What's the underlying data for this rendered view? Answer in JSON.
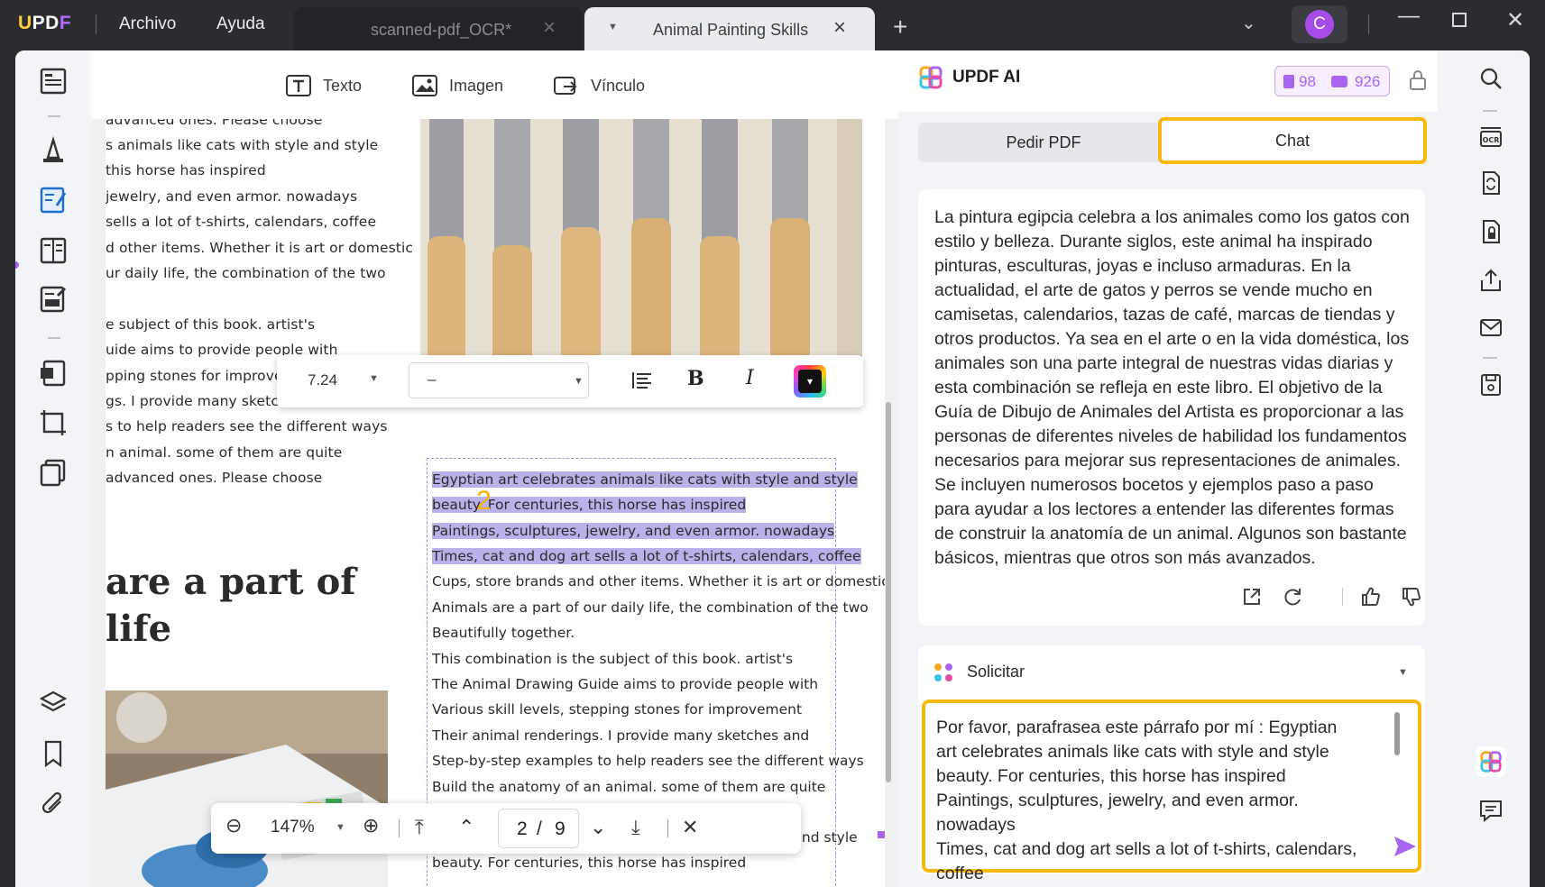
{
  "titlebar": {
    "logo": "UPDF",
    "menu": [
      "Archivo",
      "Ayuda"
    ],
    "tabs": [
      {
        "label": "scanned-pdf_OCR*",
        "active": false
      },
      {
        "label": "Animal Painting Skills",
        "active": true
      }
    ],
    "avatar_initial": "C"
  },
  "doc_toolbar": {
    "tools": [
      {
        "label": "Texto",
        "icon": "text-tool-icon"
      },
      {
        "label": "Imagen",
        "icon": "image-tool-icon"
      },
      {
        "label": "Vínculo",
        "icon": "link-tool-icon"
      }
    ]
  },
  "left_column_lines": [
    "advanced ones. Please choose",
    "s animals like cats with style and style",
    "this horse has inspired",
    "jewelry, and even armor. nowadays",
    "sells a lot of t-shirts, calendars, coffee",
    "d other items. Whether it is art or domestic",
    "ur daily life, the combination of the two",
    "",
    "e subject of this book. artist's",
    "uide aims to provide people with",
    "pping stones for improveme",
    "gs. I provide many sketches a",
    "s to help readers see the different ways",
    "n animal. some of them are quite",
    "advanced ones. Please choose"
  ],
  "left_heading": [
    "are a part of",
    " life"
  ],
  "text_box": {
    "lines": [
      {
        "text": "Egyptian art celebrates animals like cats with style and style",
        "highlight": true
      },
      {
        "text": "beauty. For centuries, this horse has inspired",
        "highlight": true
      },
      {
        "text": "Paintings, sculptures, jewelry, and even armor. nowadays",
        "highlight": true
      },
      {
        "text": "Times, cat and dog art sells a lot of t-shirts, calendars, coffee",
        "highlight": true
      },
      {
        "text": "Cups, store brands and other items. Whether it is art or domestic",
        "highlight": false
      },
      {
        "text": "Animals are a part of our daily life, the combination of the two",
        "highlight": false
      },
      {
        "text": "Beautifully together.",
        "highlight": false
      },
      {
        "text": "This combination is the subject of this book. artist's",
        "highlight": false
      },
      {
        "text": "The Animal Drawing Guide aims to provide people with",
        "highlight": false
      },
      {
        "text": "Various skill levels, stepping stones for improvement",
        "highlight": false
      },
      {
        "text": "Their animal renderings. I provide many sketches and",
        "highlight": false
      },
      {
        "text": "Step-by-step examples to help readers see the different ways",
        "highlight": false
      },
      {
        "text": "Build the anatomy of an animal. some of them are quite",
        "highlight": false
      },
      {
        "text": "se",
        "highlight": false
      },
      {
        "text": "Egyptian art celebrates animals like cats with style and style",
        "highlight": false
      },
      {
        "text": "beauty. For centuries, this horse has inspired",
        "highlight": false
      }
    ]
  },
  "format_bar": {
    "font_size": "7.24",
    "font_name": "–",
    "bold": "B",
    "italic": "I"
  },
  "zoom_bar": {
    "zoom": "147%",
    "current_page": "2",
    "page_sep": "/",
    "total_pages": "9"
  },
  "markers": {
    "one": "1",
    "two": "2"
  },
  "ai_panel": {
    "title": "UPDF AI",
    "credits_pdf": "98",
    "credits_chat": "926",
    "tabs": {
      "ask_pdf": "Pedir PDF",
      "chat": "Chat"
    },
    "answer": "La pintura egipcia celebra a los animales como los gatos con estilo y belleza. Durante siglos, este animal ha inspirado pinturas, esculturas, joyas e incluso armaduras. En la actualidad, el arte de gatos y perros se vende mucho en camisetas, calendarios, tazas de café, marcas de tiendas y otros productos. Ya sea en el arte o en la vida doméstica, los animales son una parte integral de nuestras vidas diarias y esta combinación se refleja en este libro. El objetivo de la Guía de Dibujo de Animales del Artista es proporcionar a las personas de diferentes niveles de habilidad los fundamentos necesarios para mejorar sus representaciones de animales. Se incluyen numerosos bocetos y ejemplos paso a paso para ayudar a los lectores a entender las diferentes formas de construir la anatomía de un animal. Algunos son bastante básicos, mientras que otros son más avanzados.",
    "prompt_label": "Solicitar",
    "prompt_text": "Por favor, parafrasea este párrafo por mí : Egyptian art celebrates animals like cats with style and style\nbeauty. For centuries, this horse has inspired\nPaintings, sculptures, jewelry, and even armor. nowadays\nTimes, cat and dog art sells a lot of t-shirts, calendars, coffee"
  },
  "colors": {
    "accent_purple": "#a964f0",
    "highlight_yellow": "#f6b90e",
    "text_highlight": "#b9b2ea"
  }
}
